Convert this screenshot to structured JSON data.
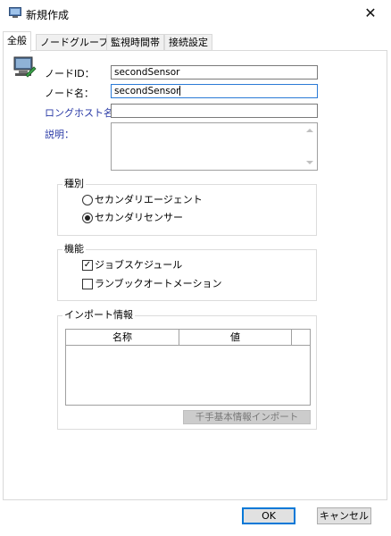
{
  "window": {
    "title": "新規作成",
    "close": "✕"
  },
  "tabs": [
    {
      "label": "全般",
      "active": true
    },
    {
      "label": "ノードグループ"
    },
    {
      "label": "監視時間帯"
    },
    {
      "label": "接続設定"
    }
  ],
  "form": {
    "node_id_label": "ノードID：",
    "node_id_value": "secondSensor",
    "node_name_label": "ノード名：",
    "node_name_value": "secondSensor",
    "long_host_label": "ロングホスト名：",
    "long_host_value": "",
    "description_label": "説明：",
    "description_value": ""
  },
  "type_group": {
    "title": "種別",
    "options": [
      {
        "label": "セカンダリエージェント",
        "selected": false
      },
      {
        "label": "セカンダリセンサー",
        "selected": true
      }
    ]
  },
  "function_group": {
    "title": "機能",
    "options": [
      {
        "label": "ジョブスケジュール",
        "checked": true
      },
      {
        "label": "ランブックオートメーション",
        "checked": false
      }
    ]
  },
  "import_group": {
    "title": "インポート情報",
    "columns": [
      "名称",
      "値"
    ],
    "rows": [],
    "import_button": "千手基本情報インポート"
  },
  "footer": {
    "ok": "OK",
    "cancel": "キャンセル"
  }
}
